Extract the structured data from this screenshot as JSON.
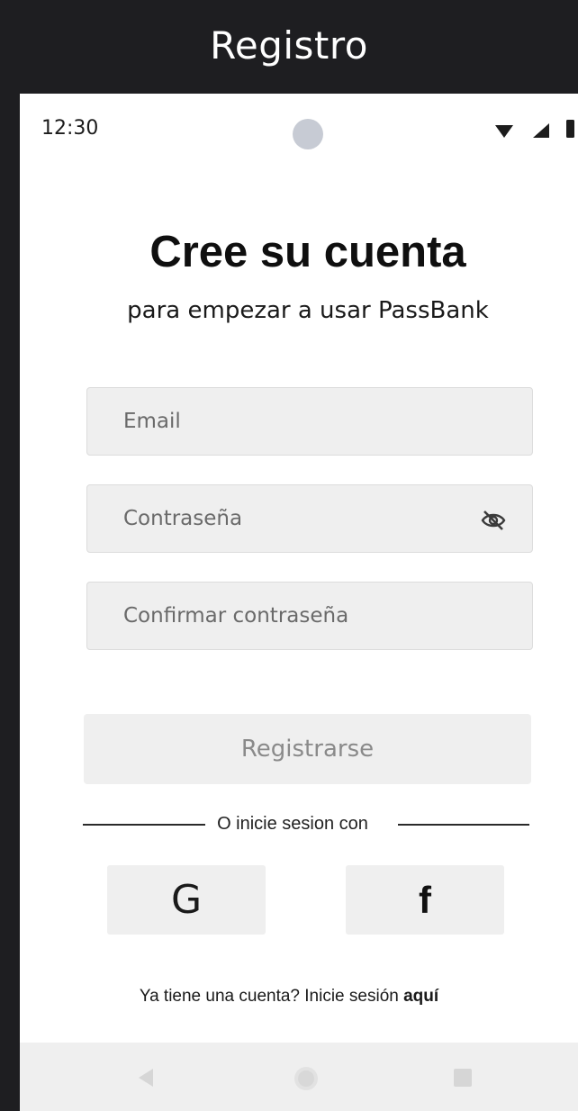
{
  "frame": {
    "title": "Registro"
  },
  "status_bar": {
    "time": "12:30",
    "icons": [
      "wifi-icon",
      "signal-icon",
      "battery-icon"
    ]
  },
  "header": {
    "title": "Cree su cuenta",
    "subtitle": "para empezar a usar PassBank"
  },
  "form": {
    "email": {
      "placeholder": "Email",
      "value": ""
    },
    "password": {
      "placeholder": "Contraseña",
      "value": "",
      "toggle_icon": "eye-off-icon"
    },
    "confirm_password": {
      "placeholder": "Confirmar contraseña",
      "value": ""
    },
    "submit_label": "Registrarse"
  },
  "social": {
    "divider_text": "O inicie sesion con",
    "google_label": "G",
    "facebook_label": "f"
  },
  "footer": {
    "prompt": "Ya tiene una cuenta? Inicie sesión",
    "link": "aquí"
  },
  "nav": {
    "icons": [
      "back-icon",
      "home-icon",
      "recents-icon"
    ]
  },
  "colors": {
    "background": "#1e1e21",
    "surface": "#ffffff",
    "field": "#efefef",
    "disabled_text": "#8a8a8a"
  }
}
